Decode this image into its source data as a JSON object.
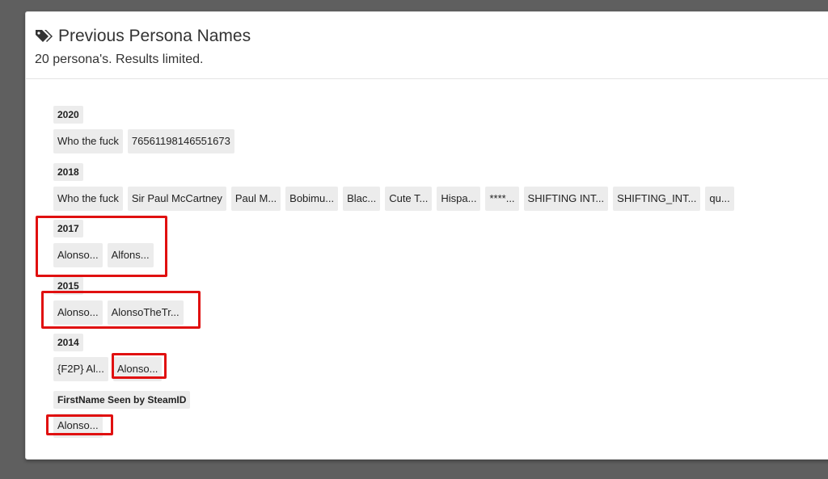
{
  "header": {
    "title": "Previous Persona Names",
    "subtitle": "20 persona's. Results limited.",
    "icon": "tags-icon"
  },
  "groups": [
    {
      "label": "2020",
      "names": [
        "Who the fuck",
        "76561198146551673"
      ]
    },
    {
      "label": "2018",
      "names": [
        "Who the fuck",
        "Sir Paul McCartney",
        "Paul M...",
        "Bobimu...",
        "Blac...",
        "Cute T...",
        "Hispa...",
        "****...",
        "SHIFTING INT...",
        "SHIFTING_INT...",
        "qu..."
      ]
    },
    {
      "label": "2017",
      "names": [
        "Alonso...",
        "Alfons..."
      ]
    },
    {
      "label": "2015",
      "names": [
        "Alonso...",
        "AlonsoTheTr..."
      ]
    },
    {
      "label": "2014",
      "names": [
        "{F2P} Al...",
        "Alonso..."
      ]
    },
    {
      "label": "FirstName Seen by SteamID",
      "names": [
        "Alonso..."
      ]
    }
  ],
  "colors": {
    "highlight": "#e01010",
    "chip_bg": "#ececec",
    "backdrop": "#5f5f5f"
  }
}
